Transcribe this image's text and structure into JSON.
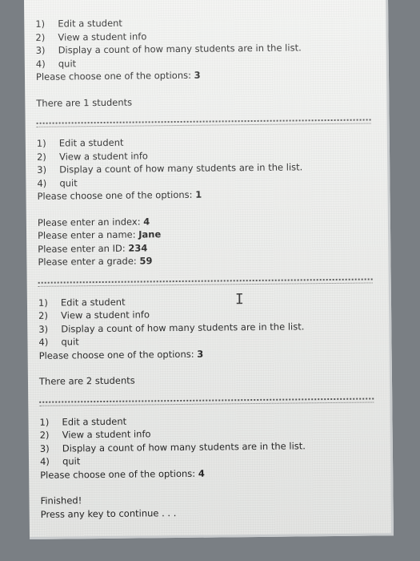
{
  "console": {
    "block1": {
      "menu": [
        {
          "num": "1)",
          "label": "Edit a student"
        },
        {
          "num": "2)",
          "label": "View a student info"
        },
        {
          "num": "3)",
          "label": "Display a count of how many students are in the list."
        },
        {
          "num": "4)",
          "label": "quit"
        }
      ],
      "prompt": "Please choose one of the options: ",
      "answer": "3",
      "result": "There are 1 students"
    },
    "block2": {
      "menu": [
        {
          "num": "1)",
          "label": "Edit a student"
        },
        {
          "num": "2)",
          "label": "View a student info"
        },
        {
          "num": "3)",
          "label": "Display a count of how many students are in the list."
        },
        {
          "num": "4)",
          "label": "quit"
        }
      ],
      "prompt": "Please choose one of the options: ",
      "answer": "1",
      "inputs": [
        {
          "prompt": "Please enter an index: ",
          "value": "4"
        },
        {
          "prompt": "Please enter a name: ",
          "value": "Jane"
        },
        {
          "prompt": "Please enter an ID: ",
          "value": "234"
        },
        {
          "prompt": "Please enter a grade: ",
          "value": "59"
        }
      ]
    },
    "block3": {
      "menu": [
        {
          "num": "1)",
          "label": "Edit a student"
        },
        {
          "num": "2)",
          "label": "View a student info"
        },
        {
          "num": "3)",
          "label": "Display a count of how many students are in the list."
        },
        {
          "num": "4)",
          "label": "quit"
        }
      ],
      "prompt": "Please choose one of the options: ",
      "answer": "3",
      "result": "There are 2 students"
    },
    "block4": {
      "menu": [
        {
          "num": "1)",
          "label": "Edit a student"
        },
        {
          "num": "2)",
          "label": "View a student info"
        },
        {
          "num": "3)",
          "label": "Display a count of how many students are in the list."
        },
        {
          "num": "4)",
          "label": "quit"
        }
      ],
      "prompt": "Please choose one of the options: ",
      "answer": "4",
      "finished": "Finished!",
      "continue": "Press any key to continue . . ."
    }
  }
}
